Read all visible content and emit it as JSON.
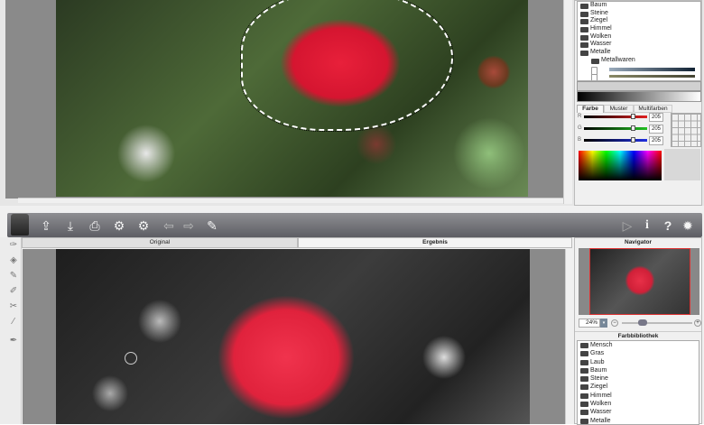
{
  "top_window": {
    "library_items": [
      "Baum",
      "Steine",
      "Ziegel",
      "Himmel",
      "Wolken",
      "Wasser",
      "Metalle"
    ],
    "library_subfolder": "Metallwaren",
    "color_tabs": [
      "Farbe",
      "Muster",
      "Multifarben"
    ],
    "rgb": {
      "labels": [
        "R",
        "G",
        "B"
      ],
      "values": [
        "205",
        "205",
        "205"
      ],
      "colors": [
        "#e02020",
        "#20c020",
        "#2030e0"
      ]
    }
  },
  "bottom_window": {
    "toolbar": {
      "icons": [
        "open-icon",
        "save-icon",
        "print-icon",
        "export-settings-icon",
        "import-settings-icon",
        "undo-icon",
        "redo-icon",
        "colorize-icon",
        "play-icon",
        "info-icon",
        "help-icon",
        "settings-icon"
      ]
    },
    "tabs": {
      "original": "Original",
      "result": "Ergebnis"
    },
    "navigator": {
      "title": "Navigator",
      "zoom": "24%"
    },
    "library": {
      "title": "Farbbibliothek",
      "items": [
        "Mensch",
        "Gras",
        "Laub",
        "Baum",
        "Steine",
        "Ziegel",
        "Himmel",
        "Wolken",
        "Wasser",
        "Metalle"
      ]
    }
  }
}
